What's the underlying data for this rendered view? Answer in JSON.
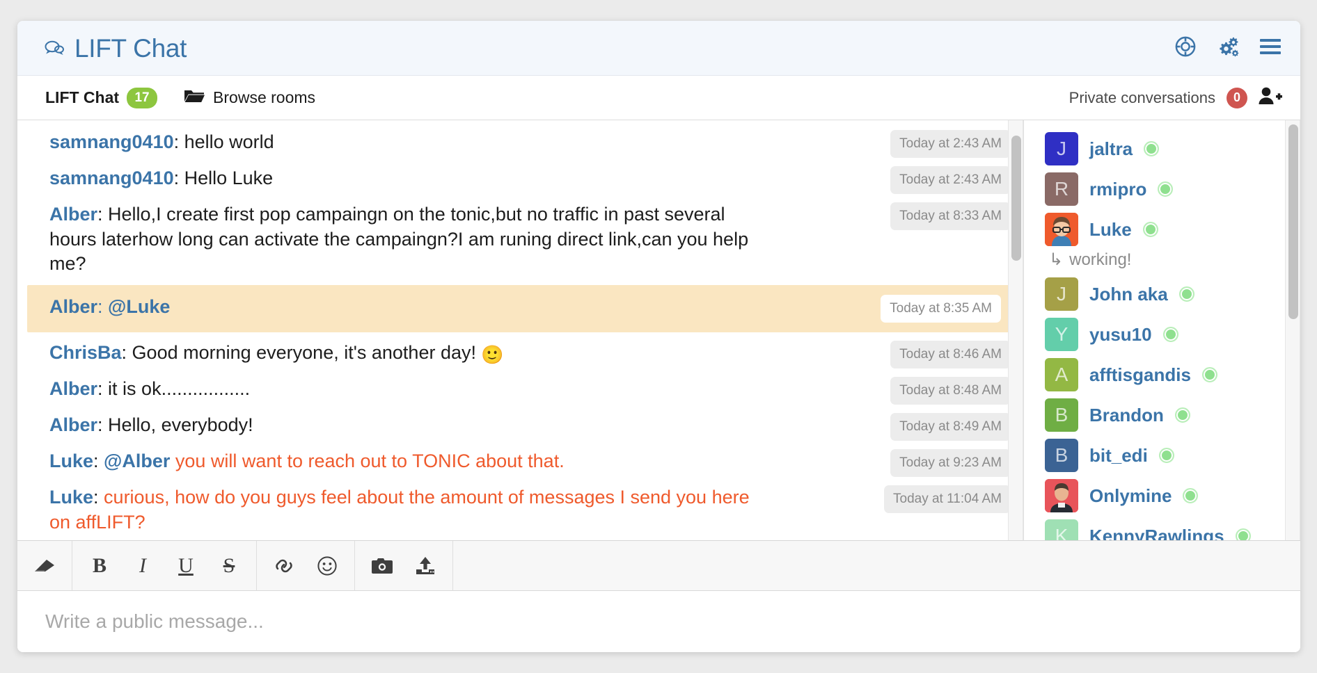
{
  "header": {
    "title": "LIFT Chat",
    "brand_icon": "chat-bubbles-icon",
    "accent_color": "#3b74a8",
    "actions": [
      {
        "name": "help-lifebuoy-icon",
        "label": "Help"
      },
      {
        "name": "settings-gears-icon",
        "label": "Settings"
      },
      {
        "name": "menu-hamburger-icon",
        "label": "Menu"
      }
    ]
  },
  "subbar": {
    "room_name": "LIFT Chat",
    "room_count": "17",
    "room_count_color": "#8dc63f",
    "browse_rooms_label": "Browse rooms",
    "browse_rooms_icon": "folder-open-icon",
    "private_label": "Private conversations",
    "private_count": "0",
    "private_count_color": "#cf5550",
    "add_user_icon": "add-user-icon"
  },
  "messages": [
    {
      "author": "samnang0410",
      "text": "hello world",
      "time": "Today at 2:43 AM",
      "highlight": false,
      "orange": false
    },
    {
      "author": "samnang0410",
      "text": "Hello Luke",
      "time": "Today at 2:43 AM",
      "highlight": false,
      "orange": false
    },
    {
      "author": "Alber",
      "text": "Hello,I create first pop campaingn on the tonic,but no traffic in past several hours laterhow long can activate the campaingn?I am runing direct link,can you help me?",
      "time": "Today at 8:33 AM",
      "highlight": false,
      "orange": false
    },
    {
      "author": "Alber",
      "mention": "@Luke",
      "text": "",
      "time": "Today at 8:35 AM",
      "highlight": true,
      "orange": false
    },
    {
      "author": "ChrisBa",
      "text": "Good morning everyone, it's another day!",
      "emoji": "🙂",
      "time": "Today at 8:46 AM",
      "highlight": false,
      "orange": false
    },
    {
      "author": "Alber",
      "text": "it is ok.................",
      "time": "Today at 8:48 AM",
      "highlight": false,
      "orange": false
    },
    {
      "author": "Alber",
      "text": "Hello, everybody!",
      "time": "Today at 8:49 AM",
      "highlight": false,
      "orange": false
    },
    {
      "author": "Luke",
      "mention": "@Alber",
      "text": " you will want to reach out to TONIC about that.",
      "time": "Today at 9:23 AM",
      "highlight": false,
      "orange": true
    },
    {
      "author": "Luke",
      "text": "curious, how do you guys feel about the amount of messages I send you here on affLIFT?",
      "time": "Today at 11:04 AM",
      "highlight": false,
      "orange": true
    }
  ],
  "users": [
    {
      "name": "jaltra",
      "initial": "J",
      "avatar_color": "#2f2fc4",
      "avatar_type": "letter",
      "online": true
    },
    {
      "name": "rmipro",
      "initial": "R",
      "avatar_color": "#8a6a66",
      "avatar_type": "letter",
      "online": true
    },
    {
      "name": "Luke",
      "initial": "L",
      "avatar_color": "#ef5a2c",
      "avatar_type": "photo-cartoon",
      "online": true,
      "status": "working!"
    },
    {
      "name": "John aka",
      "initial": "J",
      "avatar_color": "#a5a047",
      "avatar_type": "letter",
      "online": true
    },
    {
      "name": "yusu10",
      "initial": "Y",
      "avatar_color": "#63ceaa",
      "avatar_type": "letter",
      "online": true
    },
    {
      "name": "afftisgandis",
      "initial": "A",
      "avatar_color": "#93b844",
      "avatar_type": "letter",
      "online": true
    },
    {
      "name": "Brandon",
      "initial": "B",
      "avatar_color": "#6fae44",
      "avatar_type": "letter",
      "online": true
    },
    {
      "name": "bit_edi",
      "initial": "B",
      "avatar_color": "#3b6394",
      "avatar_type": "letter",
      "online": true
    },
    {
      "name": "Onlymine",
      "initial": "O",
      "avatar_color": "#e8545a",
      "avatar_type": "photo-person",
      "online": true
    },
    {
      "name": "KennyRawlings",
      "initial": "K",
      "avatar_color": "#9fe0b4",
      "avatar_type": "letter",
      "online": true
    }
  ],
  "status_arrow": "↳",
  "editor": {
    "tools_group1": [
      {
        "name": "eraser-icon",
        "glyph": ""
      }
    ],
    "tools_group2": [
      {
        "name": "bold-button",
        "glyph": "B"
      },
      {
        "name": "italic-button",
        "glyph": "I"
      },
      {
        "name": "underline-button",
        "glyph": "U"
      },
      {
        "name": "strikethrough-button",
        "glyph": "S"
      }
    ],
    "tools_group3": [
      {
        "name": "link-icon",
        "glyph": ""
      },
      {
        "name": "smiley-icon",
        "glyph": ""
      }
    ],
    "tools_group4": [
      {
        "name": "camera-icon",
        "glyph": ""
      },
      {
        "name": "upload-icon",
        "glyph": ""
      }
    ],
    "placeholder": "Write a public message..."
  }
}
